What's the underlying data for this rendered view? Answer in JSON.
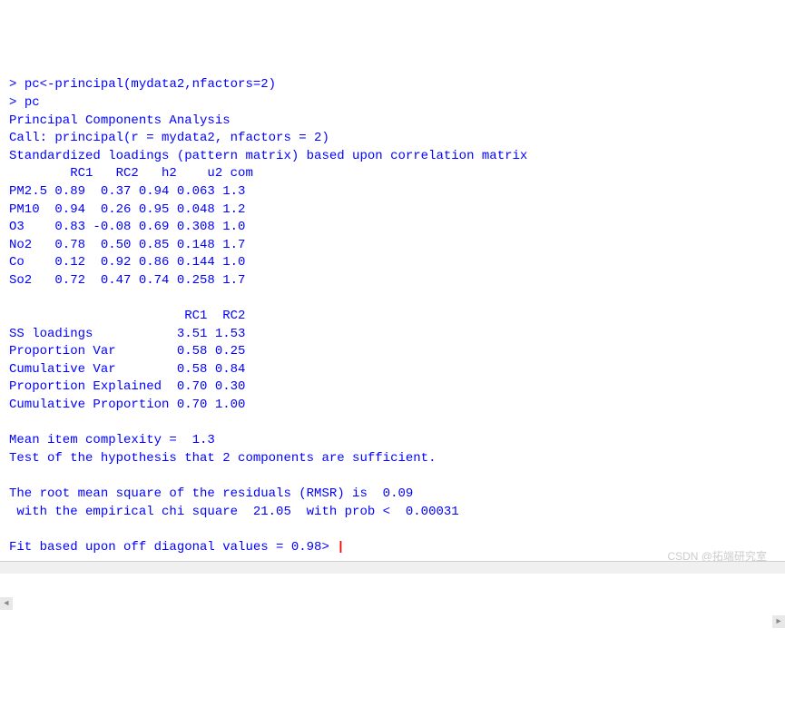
{
  "console": {
    "prompt_char": ">",
    "command1": "pc<-principal(mydata2,nfactors=2)",
    "command2": "pc",
    "title_line": "Principal Components Analysis",
    "call_line": "Call: principal(r = mydata2, nfactors = 2)",
    "loadings_header": "Standardized loadings (pattern matrix) based upon correlation matrix",
    "loadings_col_header": "        RC1   RC2   h2    u2 com",
    "loadings_rows": [
      "PM2.5 0.89  0.37 0.94 0.063 1.3",
      "PM10  0.94  0.26 0.95 0.048 1.2",
      "O3    0.83 -0.08 0.69 0.308 1.0",
      "No2   0.78  0.50 0.85 0.148 1.7",
      "Co    0.12  0.92 0.86 0.144 1.0",
      "So2   0.72  0.47 0.74 0.258 1.7"
    ],
    "variance_header": "                       RC1  RC2",
    "variance_rows": [
      "SS loadings           3.51 1.53",
      "Proportion Var        0.58 0.25",
      "Cumulative Var        0.58 0.84",
      "Proportion Explained  0.70 0.30",
      "Cumulative Proportion 0.70 1.00"
    ],
    "mean_complexity": "Mean item complexity =  1.3",
    "hypothesis_test": "Test of the hypothesis that 2 components are sufficient.",
    "rmsr_line": "The root mean square of the residuals (RMSR) is  0.09",
    "chisq_line": " with the empirical chi square  21.05  with prob <  0.00031 ",
    "fit_line": "Fit based upon off diagonal values = 0.98",
    "cursor": "|"
  },
  "watermark": "CSDN @拓端研究室"
}
